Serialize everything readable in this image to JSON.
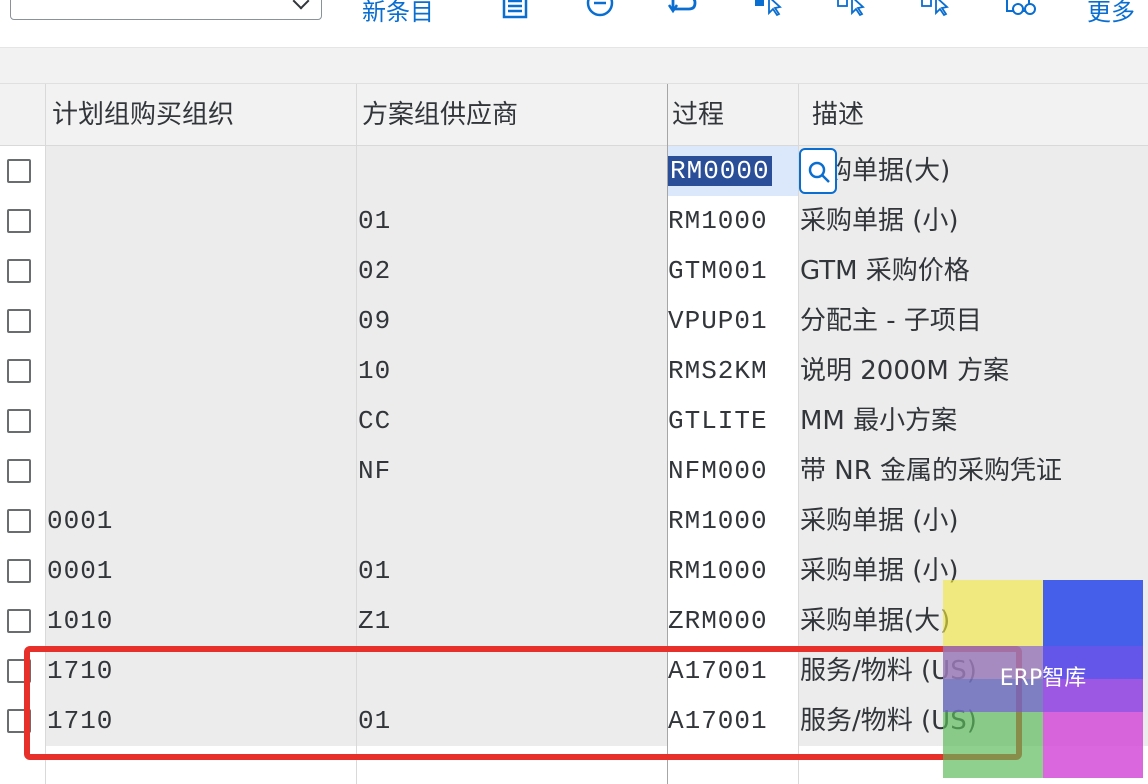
{
  "toolbar": {
    "new_entries": "新条目",
    "more": "更多",
    "icons": [
      "details-icon",
      "remove-icon",
      "undo-icon",
      "select-all-icon",
      "select-block-icon",
      "deselect-all-icon",
      "glasses-icon"
    ]
  },
  "table": {
    "headers": {
      "purch_org": "计划组购买组织",
      "vendor_group": "方案组供应商",
      "procedure": "过程",
      "description": "描述"
    },
    "rows": [
      {
        "purch_org": "",
        "vendor_group": "",
        "procedure": "RM0000",
        "description": "采购单据(大)"
      },
      {
        "purch_org": "",
        "vendor_group": "01",
        "procedure": "RM1000",
        "description": "采购单据 (小)"
      },
      {
        "purch_org": "",
        "vendor_group": "02",
        "procedure": "GTM001",
        "description": "GTM 采购价格"
      },
      {
        "purch_org": "",
        "vendor_group": "09",
        "procedure": "VPUP01",
        "description": "分配主 - 子项目"
      },
      {
        "purch_org": "",
        "vendor_group": "10",
        "procedure": "RMS2KM",
        "description": "说明 2000M 方案"
      },
      {
        "purch_org": "",
        "vendor_group": "CC",
        "procedure": "GTLITE",
        "description": "MM 最小方案"
      },
      {
        "purch_org": "",
        "vendor_group": "NF",
        "procedure": "NFM000",
        "description": "带 NR 金属的采购凭证"
      },
      {
        "purch_org": "0001",
        "vendor_group": "",
        "procedure": "RM1000",
        "description": "采购单据 (小)"
      },
      {
        "purch_org": "0001",
        "vendor_group": "01",
        "procedure": "RM1000",
        "description": "采购单据 (小)"
      },
      {
        "purch_org": "1010",
        "vendor_group": "Z1",
        "procedure": "ZRM000",
        "description": "采购单据(大)"
      },
      {
        "purch_org": "1710",
        "vendor_group": "",
        "procedure": "A17001",
        "description": "服务/物料 (US)"
      },
      {
        "purch_org": "1710",
        "vendor_group": "01",
        "procedure": "A17001",
        "description": "服务/物料 (US)"
      }
    ]
  },
  "watermark": {
    "text": "ERP智库",
    "colors": [
      "#f0e63c",
      "#2846eb",
      "#5ab95a",
      "#d246d7"
    ]
  },
  "highlight_color": "#e8302a"
}
